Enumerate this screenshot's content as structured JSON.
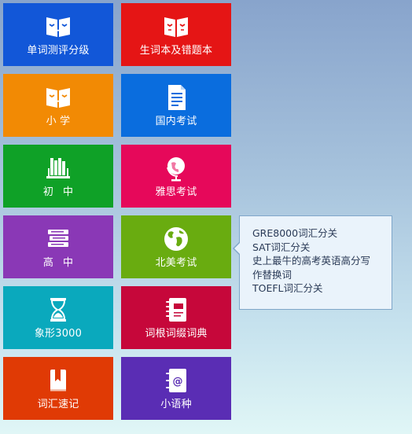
{
  "tiles": [
    {
      "label": "单词测评分级",
      "color": "#1257d8",
      "icon": "open-book-icon"
    },
    {
      "label": "生词本及错题本",
      "color": "#e51515",
      "icon": "open-book-icon"
    },
    {
      "label": "小 学",
      "color": "#f28a04",
      "icon": "open-book-icon"
    },
    {
      "label": "国内考试",
      "color": "#0a6dde",
      "icon": "document-icon"
    },
    {
      "label": "初 中",
      "color": "#0fa127",
      "icon": "bookshelf-icon"
    },
    {
      "label": "雅思考试",
      "color": "#e6085a",
      "icon": "globe-stand-icon"
    },
    {
      "label": "高 中",
      "color": "#8a38b6",
      "icon": "book-stack-icon"
    },
    {
      "label": "北美考试",
      "color": "#69ac10",
      "icon": "globe-icon"
    },
    {
      "label": "象形3000",
      "color": "#0aa9bd",
      "icon": "hourglass-icon"
    },
    {
      "label": "词根词缀词典",
      "color": "#c6073a",
      "icon": "notebook-icon"
    },
    {
      "label": "词汇速记",
      "color": "#e03a05",
      "icon": "bookmark-book-icon"
    },
    {
      "label": "小语种",
      "color": "#5a2db4",
      "icon": "address-book-icon"
    }
  ],
  "popup": {
    "items": [
      "GRE8000词汇分关",
      "SAT词汇分关",
      "史上最牛的高考英语高分写",
      "作替换词",
      "TOEFL词汇分关"
    ]
  }
}
